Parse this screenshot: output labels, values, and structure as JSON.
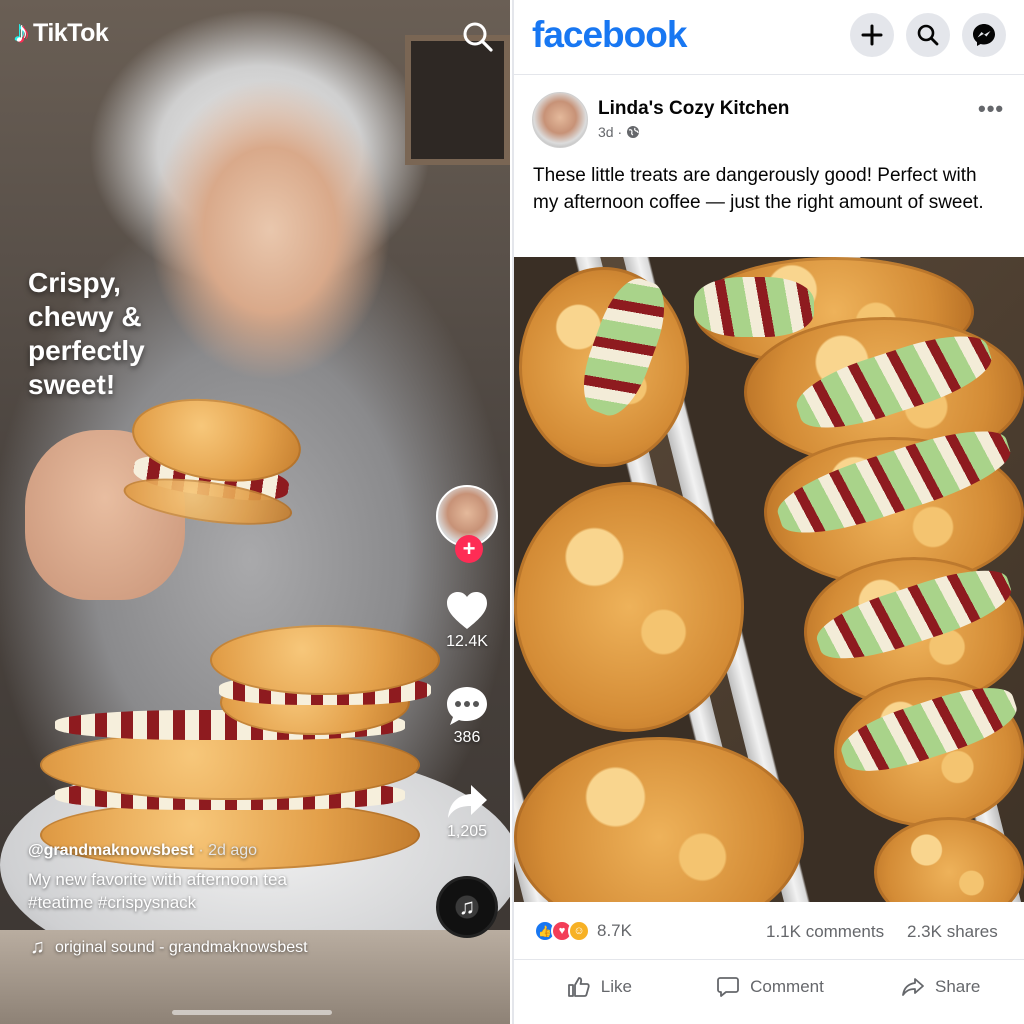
{
  "tiktok": {
    "logo_text": "TikTok",
    "search_icon": "search-icon",
    "overlay_lines": [
      "Crispy,",
      "chewy &",
      "perfectly",
      "sweet!"
    ],
    "likes": "12.4K",
    "comments": "386",
    "shares": "1,205",
    "username": "@grandmaknowsbest",
    "age": "· 2d ago",
    "caption_line1": "My new favorite with afternoon tea",
    "caption_line2": "#teatime #crispysnack",
    "sound": "original sound - grandmaknowsbest",
    "icons": [
      "heart-icon",
      "comment-icon",
      "share-icon",
      "music-note-icon",
      "follow-plus-icon"
    ],
    "colors": {
      "follow": "#fe2c55",
      "cyan": "#25f4ee"
    }
  },
  "facebook": {
    "logo_text": "facebook",
    "header_icons": [
      "plus-icon",
      "search-icon",
      "messenger-icon"
    ],
    "author": "Linda's Cozy Kitchen",
    "time": "3d ·",
    "post_text": "These little treats are dangerously good! Perfect with my afternoon coffee — just the right amount of sweet.",
    "reactions_count": "8.7K",
    "comments": "1.1K comments",
    "shares": "2.3K shares",
    "actions": {
      "like": "Like",
      "comment": "Comment",
      "share": "Share"
    },
    "colors": {
      "brand": "#1877f2",
      "love": "#f33e58",
      "haha": "#f7b125"
    }
  }
}
